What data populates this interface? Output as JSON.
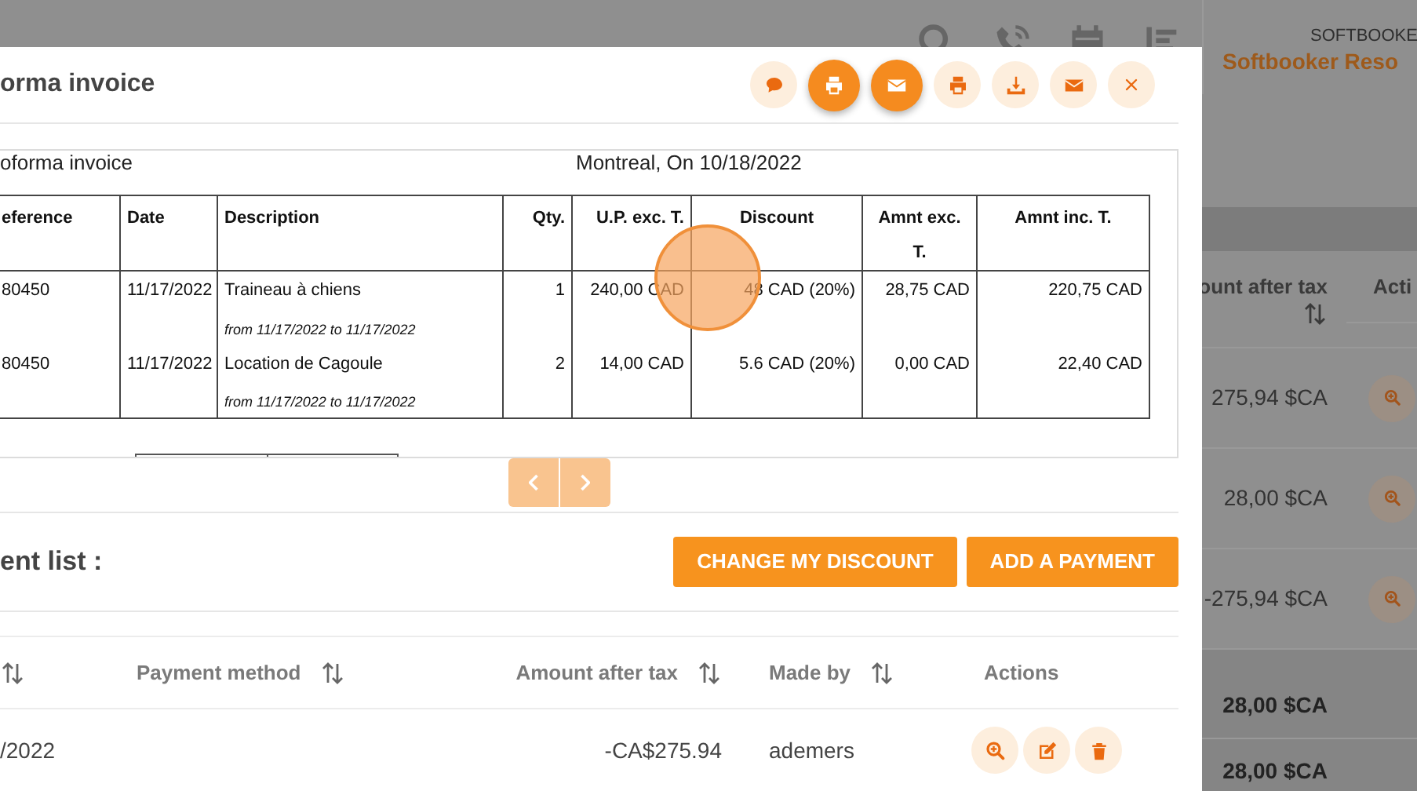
{
  "background_page": {
    "header_icons": [
      {
        "kind": "search"
      },
      {
        "kind": "phone"
      },
      {
        "kind": "calendar"
      },
      {
        "kind": "list"
      }
    ],
    "brand_caption": "SOFTBOOKE",
    "brand_name": "Softbooker Reso",
    "table": {
      "columns": [
        {
          "label": "ount after tax",
          "sortable": true
        },
        {
          "label": "Acti",
          "sortable": false
        }
      ],
      "rows": [
        {
          "kind": "payment",
          "amount": "275,94 $CA"
        },
        {
          "kind": "payment",
          "amount": "28,00 $CA"
        },
        {
          "kind": "payment",
          "amount": "-275,94 $CA"
        },
        {
          "kind": "total",
          "amount": "28,00 $CA"
        },
        {
          "kind": "total",
          "amount": "28,00 $CA"
        }
      ]
    }
  },
  "modal": {
    "title": "orma invoice",
    "header_buttons": [
      {
        "kind": "comment",
        "filled": false
      },
      {
        "kind": "print",
        "filled": true
      },
      {
        "kind": "email",
        "filled": true
      },
      {
        "kind": "print",
        "filled": false
      },
      {
        "kind": "download",
        "filled": false
      },
      {
        "kind": "email",
        "filled": false
      },
      {
        "kind": "close",
        "filled": false
      }
    ],
    "invoice_preview": {
      "heading": "oforma invoice",
      "place_date": "Montreal, On 10/18/2022",
      "columns": [
        "eference",
        "Date",
        "Description",
        "Qty.",
        "U.P. exc. T.",
        "Discount",
        "Amnt exc. T.",
        "Amnt inc. T."
      ],
      "rows": [
        {
          "reference": "80450",
          "date": "11/17/2022",
          "description": "Traineau à chiens",
          "period": "from 11/17/2022 to 11/17/2022",
          "qty": "1",
          "unit_price": "240,00 CAD",
          "discount": "48 CAD  (20%)",
          "amount_excl": "28,75 CAD",
          "amount_incl": "220,75 CAD"
        },
        {
          "reference": "80450",
          "date": "11/17/2022",
          "description": "Location de Cagoule",
          "period": "from 11/17/2022 to 11/17/2022",
          "qty": "2",
          "unit_price": "14,00 CAD",
          "discount": "5.6 CAD  (20%)",
          "amount_excl": "0,00 CAD",
          "amount_incl": "22,40 CAD"
        }
      ]
    },
    "pager": {
      "previous_disabled": true,
      "next_disabled": true
    },
    "payment_list": {
      "title": "ent list :",
      "buttons": [
        "CHANGE MY DISCOUNT",
        "ADD A PAYMENT"
      ],
      "columns": [
        {
          "sortable": true
        },
        {
          "label": "Payment method",
          "sortable": true
        },
        {
          "label": "Amount after tax",
          "sortable": true
        },
        {
          "label": "Made by",
          "sortable": true
        },
        {
          "label": "Actions",
          "sortable": false
        }
      ],
      "rows": [
        {
          "date": "/2022",
          "amount": "-CA$275.94",
          "made_by": "ademers",
          "actions": [
            {
              "kind": "view"
            },
            {
              "kind": "edit"
            },
            {
              "kind": "delete"
            }
          ]
        }
      ]
    }
  },
  "click_marker": {
    "visible": true
  }
}
